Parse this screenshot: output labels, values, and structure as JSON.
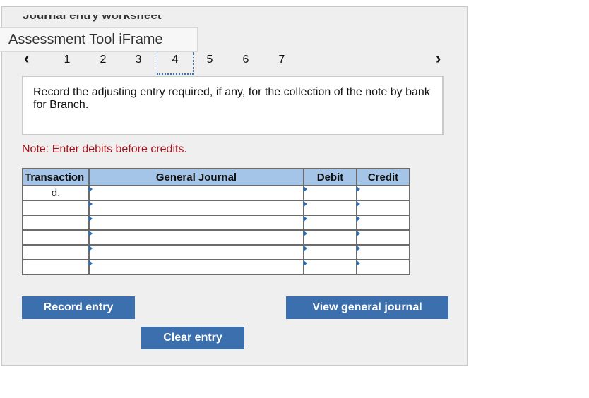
{
  "header": {
    "clipped_title": "Journal entry worksheet",
    "iframe_label": "Assessment Tool iFrame"
  },
  "nav": {
    "prev_glyph": "‹",
    "next_glyph": "›",
    "steps": [
      "1",
      "2",
      "3",
      "4",
      "5",
      "6",
      "7"
    ],
    "active_step": "4"
  },
  "question": {
    "text": "Record the adjusting entry required, if any, for the collection of the note by bank for Branch."
  },
  "note": "Note: Enter debits before credits.",
  "journal": {
    "headers": {
      "transaction": "Transaction",
      "general_journal": "General Journal",
      "debit": "Debit",
      "credit": "Credit"
    },
    "rows": [
      {
        "transaction": "d.",
        "account": "",
        "debit": "",
        "credit": ""
      },
      {
        "transaction": "",
        "account": "",
        "debit": "",
        "credit": ""
      },
      {
        "transaction": "",
        "account": "",
        "debit": "",
        "credit": ""
      },
      {
        "transaction": "",
        "account": "",
        "debit": "",
        "credit": ""
      },
      {
        "transaction": "",
        "account": "",
        "debit": "",
        "credit": ""
      },
      {
        "transaction": "",
        "account": "",
        "debit": "",
        "credit": ""
      }
    ]
  },
  "buttons": {
    "record": "Record entry",
    "view": "View general journal",
    "clear": "Clear entry"
  },
  "colors": {
    "accent": "#3c6fae",
    "header_bg": "#a5c5e8",
    "note_red": "#a3141c"
  }
}
